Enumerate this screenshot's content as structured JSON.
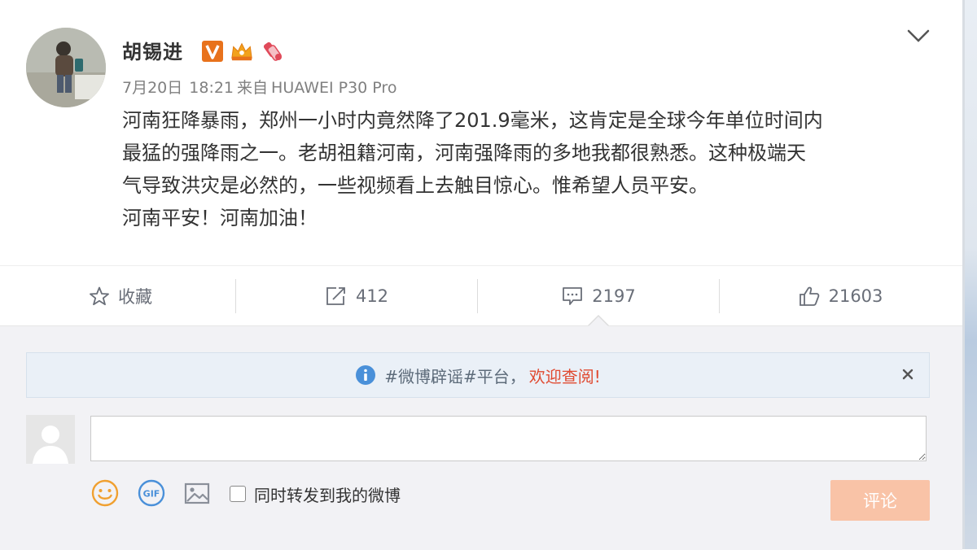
{
  "post": {
    "author": "胡锡进",
    "date": "7月20日",
    "time": "18:21",
    "source_prefix": "来自",
    "source": "HUAWEI P30 Pro",
    "content": [
      "河南狂降暴雨，郑州一小时内竟然降了201.9毫米，这肯定是全球今年单位时间内",
      "最猛的强降雨之一。老胡祖籍河南，河南强降雨的多地我都很熟悉。这种极端天",
      "气导致洪灾是必然的，一些视频看上去触目惊心。惟希望人员平安。",
      "河南平安！河南加油！"
    ]
  },
  "actions": {
    "favorite": "收藏",
    "repost_count": "412",
    "comment_count": "2197",
    "like_count": "21603"
  },
  "notice": {
    "text": "#微博辟谣#平台，",
    "link": "欢迎查阅!"
  },
  "composer": {
    "placeholder": "",
    "forward_label": "同时转发到我的微博",
    "submit_label": "评论"
  },
  "colors": {
    "accent_orange": "#f9c3a7",
    "link_red": "#e04a31",
    "icon_blue": "#4a90d9",
    "verified_badge": "#e8721c"
  }
}
